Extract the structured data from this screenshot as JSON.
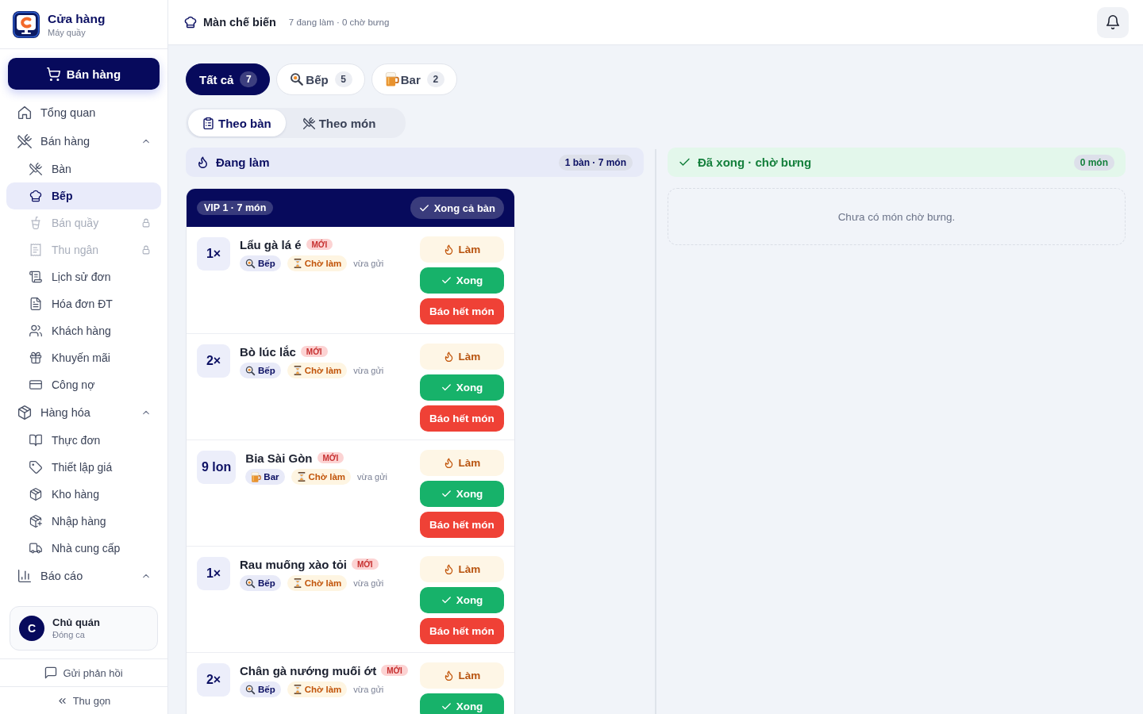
{
  "sidebar": {
    "brand": {
      "name": "Cửa hàng",
      "subtitle": "Máy quầy"
    },
    "primary_button": "Bán hàng",
    "nav": [
      {
        "kind": "link",
        "label": "Tổng quan",
        "selected": false
      },
      {
        "kind": "group",
        "label": "Bán hàng",
        "selected": false,
        "expanded": true,
        "children": [
          {
            "label": "Bàn",
            "selected": false,
            "disabled": false
          },
          {
            "label": "Bếp",
            "selected": true,
            "disabled": false
          },
          {
            "label": "Bán quầy",
            "selected": false,
            "disabled": true
          },
          {
            "label": "Thu ngân",
            "selected": false,
            "disabled": true
          },
          {
            "label": "Lịch sử đơn",
            "selected": false,
            "disabled": false
          },
          {
            "label": "Hóa đơn ĐT",
            "selected": false,
            "disabled": false
          },
          {
            "label": "Khách hàng",
            "selected": false,
            "disabled": false
          },
          {
            "label": "Khuyến mãi",
            "selected": false,
            "disabled": false
          },
          {
            "label": "Công nợ",
            "selected": false,
            "disabled": false
          }
        ]
      },
      {
        "kind": "group",
        "label": "Hàng hóa",
        "selected": false,
        "expanded": true,
        "children": [
          {
            "label": "Thực đơn",
            "selected": false,
            "disabled": false
          },
          {
            "label": "Thiết lập giá",
            "selected": false,
            "disabled": false
          },
          {
            "label": "Kho hàng",
            "selected": false,
            "disabled": false
          },
          {
            "label": "Nhập hàng",
            "selected": false,
            "disabled": false
          },
          {
            "label": "Nhà cung cấp",
            "selected": false,
            "disabled": false
          }
        ]
      },
      {
        "kind": "group",
        "label": "Báo cáo",
        "selected": false,
        "expanded": true
      }
    ],
    "user": {
      "initial": "C",
      "name": "Chủ quán",
      "status": "Đóng ca"
    },
    "feedback": "Gửi phản hồi",
    "collapse": "Thu gọn"
  },
  "header": {
    "title": "Màn chế biến",
    "summary": "7 đang làm · 0 chờ bưng"
  },
  "filters": [
    {
      "kind": "all",
      "label": "Tất cả",
      "count": "7",
      "selected": true
    },
    {
      "kind": "kitchen",
      "label": "Bếp",
      "count": "5",
      "selected": false
    },
    {
      "kind": "bar",
      "label": "Bar",
      "count": "2",
      "selected": false
    }
  ],
  "view_modes": [
    {
      "label": "Theo bàn",
      "selected": true
    },
    {
      "label": "Theo món",
      "selected": false
    }
  ],
  "columns": [
    {
      "kind": "cooking",
      "title": "Đang làm",
      "badge": "1 bàn · 7 món",
      "tables": [
        {
          "label": "VIP 1 · 7 món",
          "action": "Xong cả bàn",
          "items": [
            {
              "quantity": "1×",
              "name": "Lẩu gà lá é",
              "badge": "MỚI",
              "station": {
                "kind": "kitchen",
                "label": "Bếp"
              },
              "status": "Chờ làm",
              "sent": "vừa gửi",
              "actions": [
                {
                  "kind": "start",
                  "label": "Làm"
                },
                {
                  "kind": "done",
                  "label": "Xong"
                },
                {
                  "kind": "out",
                  "label": "Báo hết món"
                }
              ]
            },
            {
              "quantity": "2×",
              "name": "Bò lúc lắc",
              "badge": "MỚI",
              "station": {
                "kind": "kitchen",
                "label": "Bếp"
              },
              "status": "Chờ làm",
              "sent": "vừa gửi",
              "actions": [
                {
                  "kind": "start",
                  "label": "Làm"
                },
                {
                  "kind": "done",
                  "label": "Xong"
                },
                {
                  "kind": "out",
                  "label": "Báo hết món"
                }
              ]
            },
            {
              "quantity": "9 lon",
              "name": "Bia Sài Gòn",
              "badge": "MỚI",
              "station": {
                "kind": "bar",
                "label": "Bar"
              },
              "status": "Chờ làm",
              "sent": "vừa gửi",
              "actions": [
                {
                  "kind": "start",
                  "label": "Làm"
                },
                {
                  "kind": "done",
                  "label": "Xong"
                },
                {
                  "kind": "out",
                  "label": "Báo hết món"
                }
              ]
            },
            {
              "quantity": "1×",
              "name": "Rau muống xào tỏi",
              "badge": "MỚI",
              "station": {
                "kind": "kitchen",
                "label": "Bếp"
              },
              "status": "Chờ làm",
              "sent": "vừa gửi",
              "actions": [
                {
                  "kind": "start",
                  "label": "Làm"
                },
                {
                  "kind": "done",
                  "label": "Xong"
                },
                {
                  "kind": "out",
                  "label": "Báo hết món"
                }
              ]
            },
            {
              "quantity": "2×",
              "name": "Chân gà nướng muối ớt",
              "badge": "MỚI",
              "station": {
                "kind": "kitchen",
                "label": "Bếp"
              },
              "status": "Chờ làm",
              "sent": "vừa gửi",
              "actions": [
                {
                  "kind": "start",
                  "label": "Làm"
                },
                {
                  "kind": "done",
                  "label": "Xong"
                }
              ]
            }
          ]
        }
      ]
    },
    {
      "kind": "ready",
      "title": "Đã xong · chờ bưng",
      "badge": "0 món",
      "empty_text": "Chưa có món chờ bưng."
    }
  ]
}
